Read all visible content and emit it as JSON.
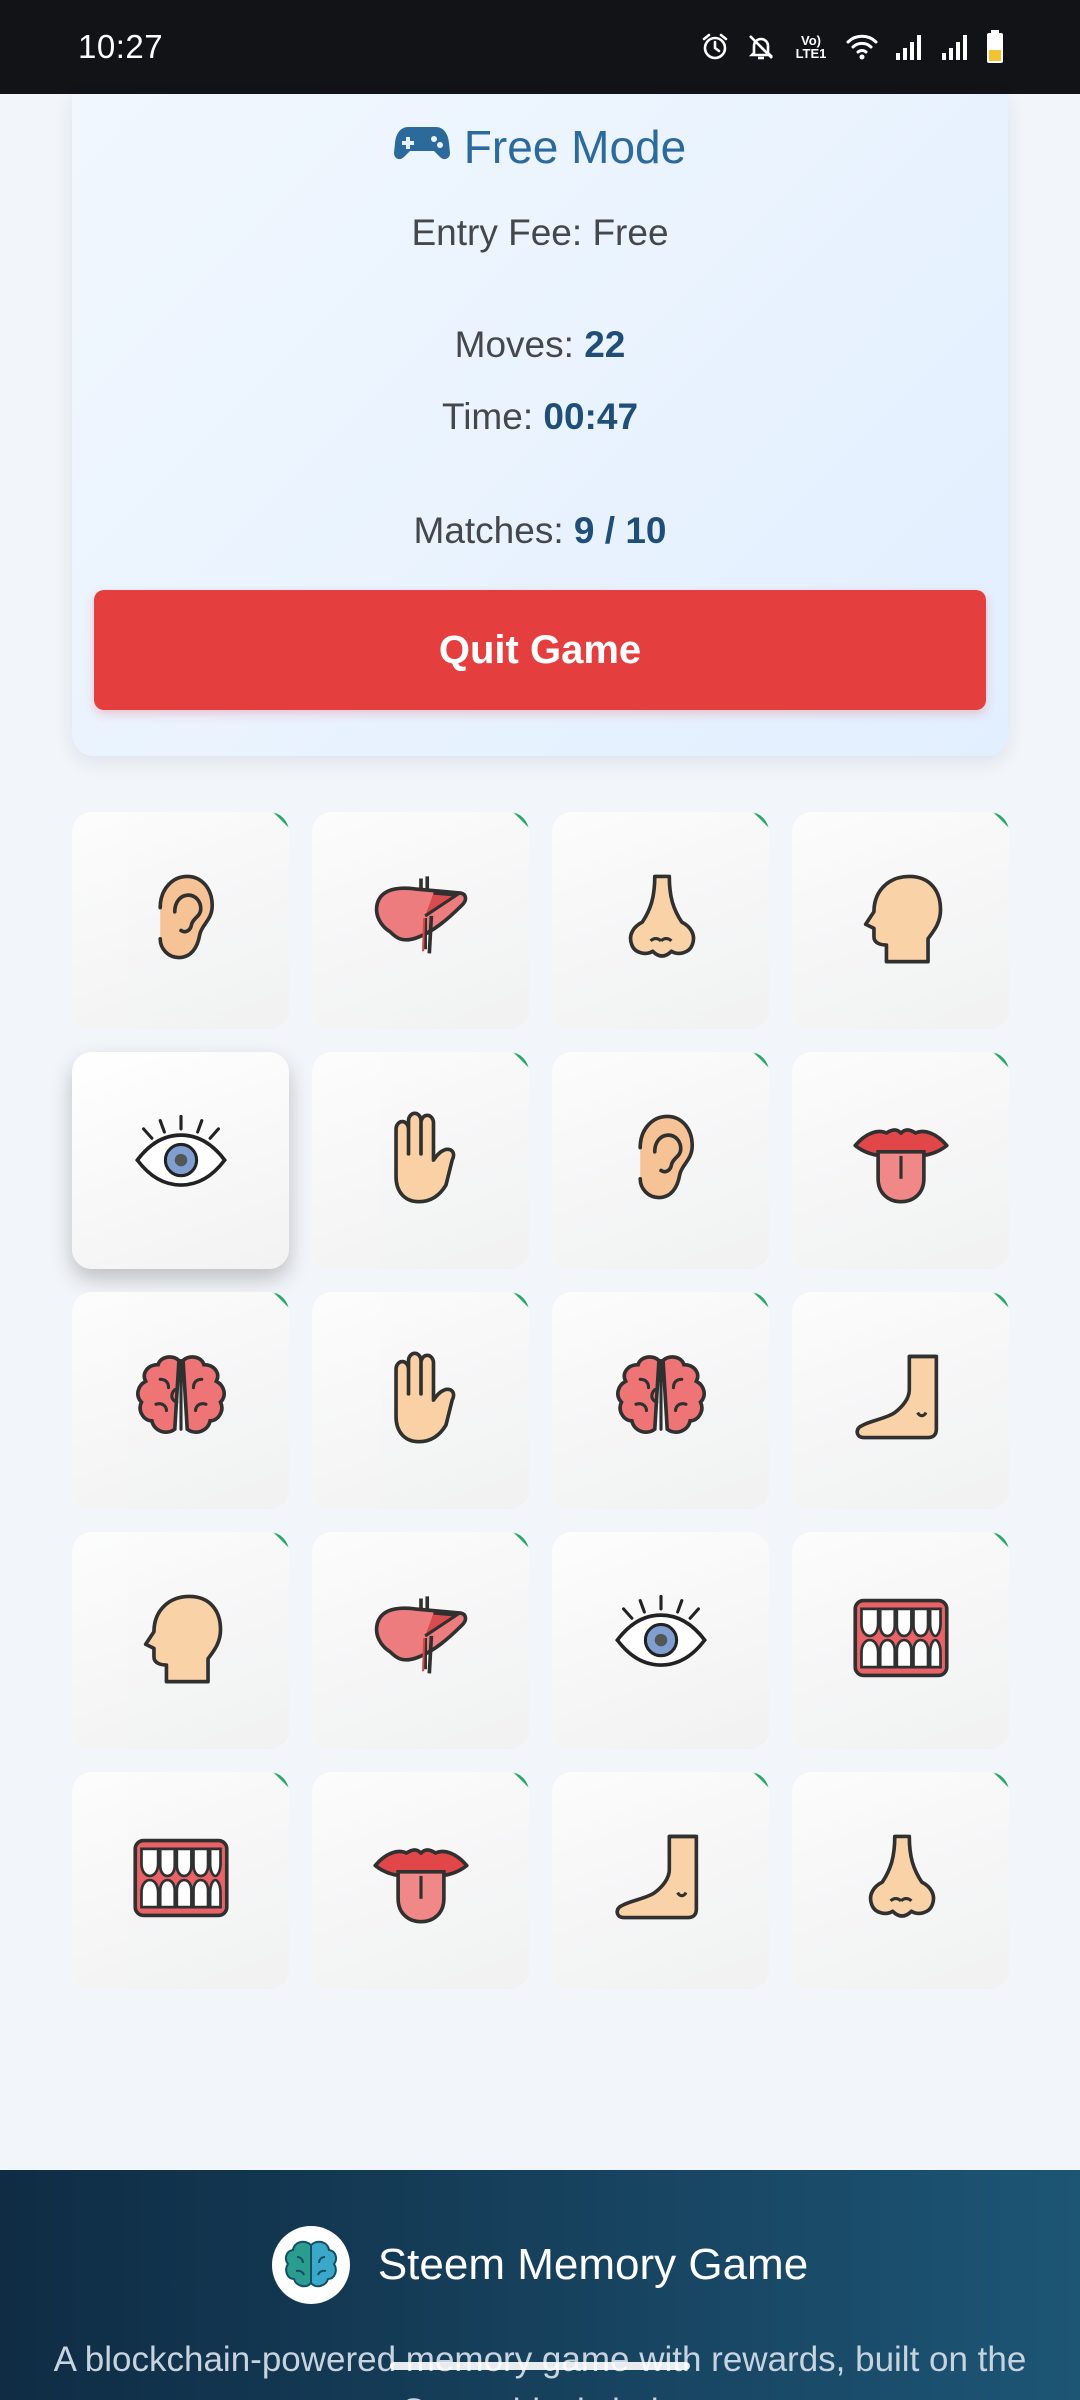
{
  "status_bar": {
    "time": "10:27",
    "network_label": "Vo) LTE1"
  },
  "game": {
    "mode_icon": "gamepad-icon",
    "mode_title": "Free Mode",
    "entry_fee": "Entry Fee: Free",
    "moves_label": "Moves:",
    "moves_value": "22",
    "time_label": "Time:",
    "time_value": "00:47",
    "matches_label": "Matches:",
    "matches_value": "9 / 10",
    "quit_label": "Quit Game"
  },
  "colors": {
    "accent": "#2c6a9c",
    "quit": "#e53e3e",
    "matched_flag": "#22a35a",
    "footer": "#0f2c44"
  },
  "cards": [
    {
      "icon": "ear",
      "matched": true,
      "selected": false
    },
    {
      "icon": "liver",
      "matched": true,
      "selected": false
    },
    {
      "icon": "nose",
      "matched": true,
      "selected": false
    },
    {
      "icon": "head",
      "matched": true,
      "selected": false
    },
    {
      "icon": "eye",
      "matched": false,
      "selected": true
    },
    {
      "icon": "hand",
      "matched": true,
      "selected": false
    },
    {
      "icon": "ear",
      "matched": true,
      "selected": false
    },
    {
      "icon": "tongue",
      "matched": true,
      "selected": false
    },
    {
      "icon": "brain",
      "matched": true,
      "selected": false
    },
    {
      "icon": "hand",
      "matched": true,
      "selected": false
    },
    {
      "icon": "brain",
      "matched": true,
      "selected": false
    },
    {
      "icon": "foot",
      "matched": true,
      "selected": false
    },
    {
      "icon": "head",
      "matched": true,
      "selected": false
    },
    {
      "icon": "liver",
      "matched": true,
      "selected": false
    },
    {
      "icon": "eye",
      "matched": false,
      "selected": false
    },
    {
      "icon": "teeth",
      "matched": true,
      "selected": false
    },
    {
      "icon": "teeth",
      "matched": true,
      "selected": false
    },
    {
      "icon": "tongue",
      "matched": true,
      "selected": false
    },
    {
      "icon": "foot",
      "matched": true,
      "selected": false
    },
    {
      "icon": "nose",
      "matched": true,
      "selected": false
    }
  ],
  "footer": {
    "logo_icon": "brain-logo-icon",
    "title": "Steem Memory Game",
    "description": "A blockchain-powered memory game with rewards, built on the Steem blockchain"
  }
}
